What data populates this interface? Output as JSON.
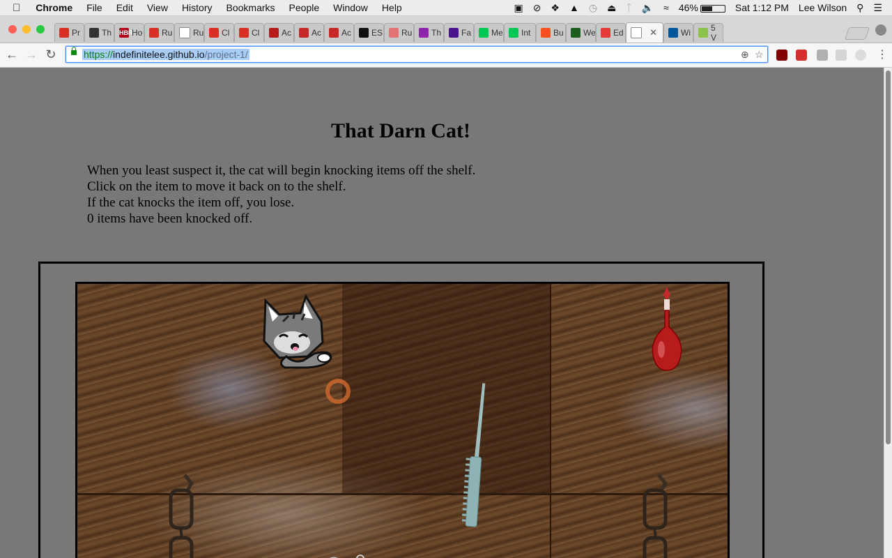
{
  "menubar": {
    "app": "Chrome",
    "menus": [
      "File",
      "Edit",
      "View",
      "History",
      "Bookmarks",
      "People",
      "Window",
      "Help"
    ],
    "battery": "46%",
    "clock": "Sat 1:12 PM",
    "user": "Lee Wilson"
  },
  "tabs": [
    {
      "label": "Pr",
      "fav_color": "#d93025"
    },
    {
      "label": "Th",
      "fav_color": "#333333"
    },
    {
      "label": "Ho",
      "fav_color": "#b3001b",
      "fav_text": "HBR"
    },
    {
      "label": "Ru",
      "fav_color": "#d93025"
    },
    {
      "label": "Ru",
      "fav_color": "#ffffff"
    },
    {
      "label": "Cl",
      "fav_color": "#d93025"
    },
    {
      "label": "Cl",
      "fav_color": "#d93025"
    },
    {
      "label": "Ac",
      "fav_color": "#b71c1c"
    },
    {
      "label": "Ac",
      "fav_color": "#c62828"
    },
    {
      "label": "Ac",
      "fav_color": "#c62828"
    },
    {
      "label": "ES",
      "fav_color": "#111111"
    },
    {
      "label": "Ru",
      "fav_color": "#e57373"
    },
    {
      "label": "Th",
      "fav_color": "#8e24aa"
    },
    {
      "label": "Fa",
      "fav_color": "#4a148c"
    },
    {
      "label": "Me",
      "fav_color": "#00c853"
    },
    {
      "label": "Int",
      "fav_color": "#00c853"
    },
    {
      "label": "Bu",
      "fav_color": "#f4511e"
    },
    {
      "label": "We",
      "fav_color": "#1b5e20"
    },
    {
      "label": "Ed",
      "fav_color": "#e53935"
    },
    {
      "label": "",
      "fav_color": "#ffffff",
      "active": true
    },
    {
      "label": "Wi",
      "fav_color": "#01579b"
    },
    {
      "label": "5 V",
      "fav_color": "#8bc34a"
    }
  ],
  "address": {
    "scheme": "https://",
    "host": "indefinitelee.github.io",
    "path": "/project-1/"
  },
  "page": {
    "title": "That Darn Cat!",
    "instructions": [
      "When you least suspect it, the cat will begin knocking items off the shelf.",
      "Click on the item to move it back on to the shelf.",
      "If the cat knocks the item off, you lose.",
      "0 items have been knocked off."
    ]
  },
  "colors": {
    "page_bg": "#787878",
    "wood": "#5c3b22",
    "url_highlight": "#a8cdf7"
  }
}
